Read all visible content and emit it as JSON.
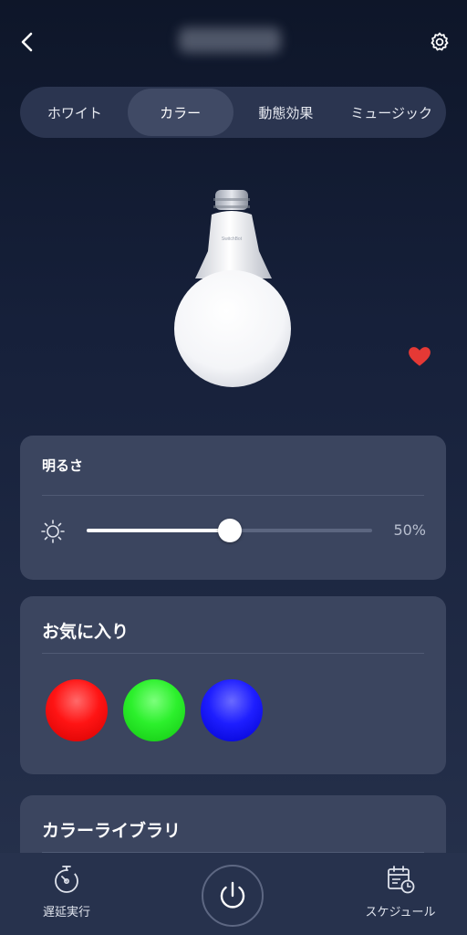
{
  "header": {
    "back_icon": "chevron-left-icon",
    "settings_icon": "gear-icon"
  },
  "tabs": [
    {
      "label": "ホワイト",
      "active": false
    },
    {
      "label": "カラー",
      "active": true
    },
    {
      "label": "動態効果",
      "active": false
    },
    {
      "label": "ミュージック",
      "active": false
    }
  ],
  "bulb": {
    "brand": "SwitchBot",
    "favorite": true,
    "favorite_color": "#e53935"
  },
  "brightness": {
    "title": "明るさ",
    "value": 50,
    "value_label": "50%",
    "icon": "sun-icon"
  },
  "favorites": {
    "title": "お気に入り",
    "colors": [
      "#ff1a1a",
      "#22ee22",
      "#1a1aff"
    ]
  },
  "color_library": {
    "title": "カラーライブラリ"
  },
  "bottom_nav": {
    "delay_label": "遅延実行",
    "schedule_label": "スケジュール",
    "power_icon": "power-icon"
  }
}
